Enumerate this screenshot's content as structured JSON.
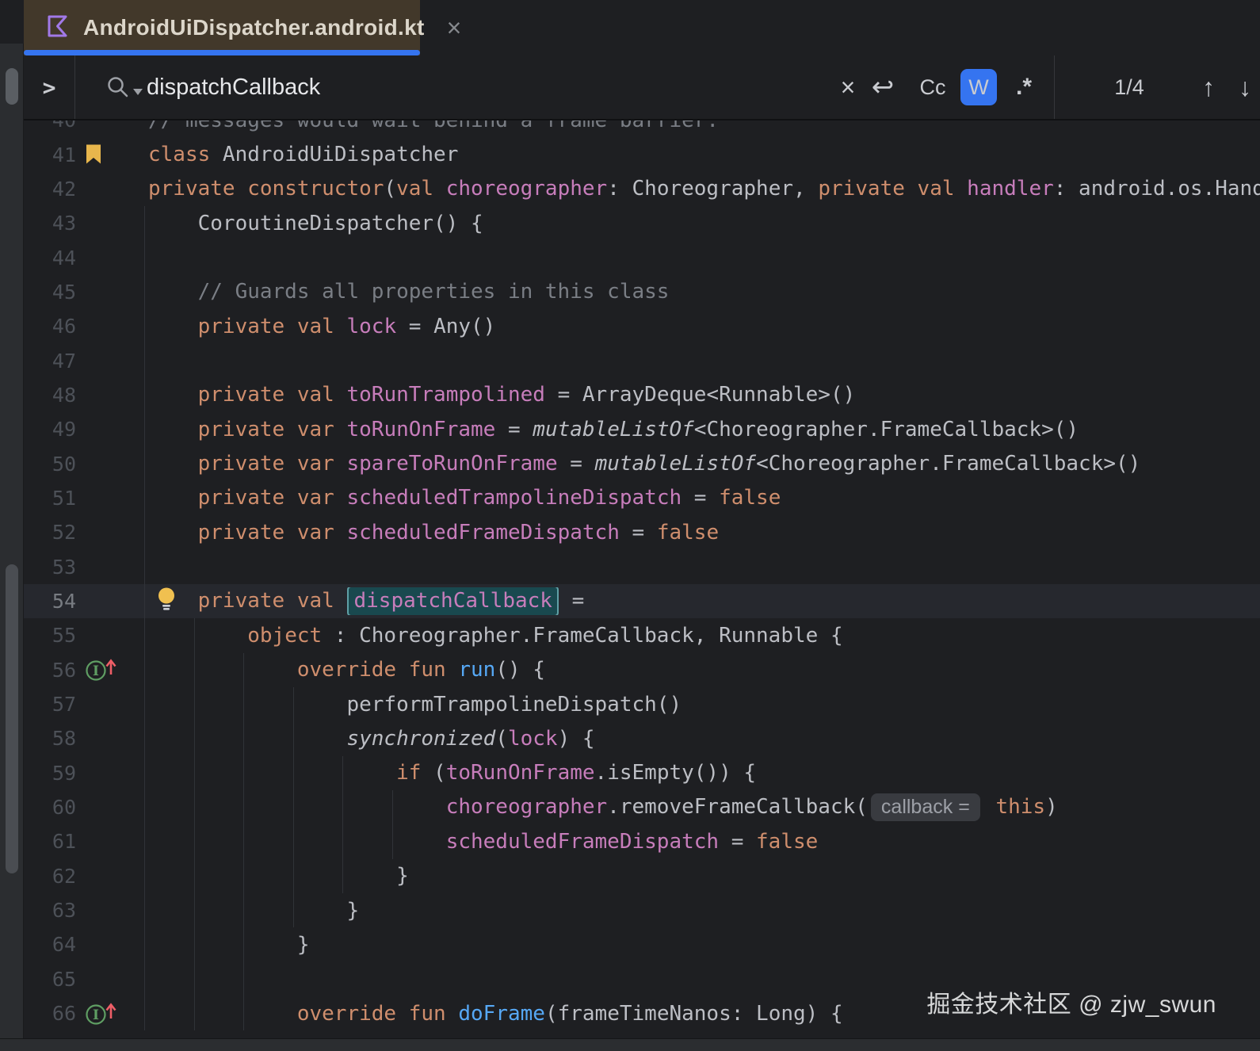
{
  "tab": {
    "title": "AndroidUiDispatcher.android.kt",
    "close_label": "×",
    "icon": "kotlin-file-icon",
    "accent_color": "#3574f0",
    "tab_color": "#42382a"
  },
  "search": {
    "expand_chevron": ">",
    "query": "dispatchCallback",
    "clear_label": "×",
    "newline_label": "↩",
    "match_case_label": "Cc",
    "words_label": "W",
    "regex_label": ".*",
    "count": "1/4",
    "prev_label": "↑",
    "next_label": "↓",
    "words_active_color": "#3574f0"
  },
  "watermark": "掘金技术社区 @ zjw_swun",
  "editor": {
    "colors": {
      "keyword": "#cf8e6d",
      "property": "#c77dbb",
      "function": "#56a8f5",
      "comment": "#7a7e85",
      "default": "#bcbec4",
      "match_bg": "#19494f",
      "current_line": "#26282e"
    },
    "guides": [
      {
        "col": 0,
        "from": 43,
        "to": 66
      },
      {
        "col": 4,
        "from": 55,
        "to": 66
      },
      {
        "col": 8,
        "from": 56,
        "to": 66
      },
      {
        "col": 12,
        "from": 57,
        "to": 63
      },
      {
        "col": 16,
        "from": 59,
        "to": 62
      },
      {
        "col": 20,
        "from": 60,
        "to": 61
      }
    ],
    "lines": [
      {
        "n": 40,
        "seg": [
          {
            "c": "c",
            "t": "// messages would wait behind a frame barrier."
          }
        ]
      },
      {
        "n": 41,
        "icon": "bookmark-icon",
        "seg": [
          {
            "c": "k",
            "t": "class"
          },
          {
            "c": "d",
            "t": " AndroidUiDispatcher"
          }
        ]
      },
      {
        "n": 42,
        "seg": [
          {
            "c": "k",
            "t": "private"
          },
          {
            "c": "d",
            "t": " "
          },
          {
            "c": "k",
            "t": "constructor"
          },
          {
            "c": "d",
            "t": "("
          },
          {
            "c": "k",
            "t": "val"
          },
          {
            "c": "d",
            "t": " "
          },
          {
            "c": "p",
            "t": "choreographer"
          },
          {
            "c": "d",
            "t": ": Choreographer, "
          },
          {
            "c": "k",
            "t": "private"
          },
          {
            "c": "d",
            "t": " "
          },
          {
            "c": "k",
            "t": "val"
          },
          {
            "c": "d",
            "t": " "
          },
          {
            "c": "p",
            "t": "handler"
          },
          {
            "c": "d",
            "t": ": android.os.Handler) :"
          }
        ]
      },
      {
        "n": 43,
        "seg": [
          {
            "c": "d",
            "t": "    CoroutineDispatcher() {"
          }
        ]
      },
      {
        "n": 44,
        "seg": []
      },
      {
        "n": 45,
        "seg": [
          {
            "c": "c",
            "t": "    // Guards all properties in this class"
          }
        ]
      },
      {
        "n": 46,
        "seg": [
          {
            "c": "d",
            "t": "    "
          },
          {
            "c": "k",
            "t": "private"
          },
          {
            "c": "d",
            "t": " "
          },
          {
            "c": "k",
            "t": "val"
          },
          {
            "c": "d",
            "t": " "
          },
          {
            "c": "p",
            "t": "lock"
          },
          {
            "c": "d",
            "t": " = Any()"
          }
        ]
      },
      {
        "n": 47,
        "seg": []
      },
      {
        "n": 48,
        "seg": [
          {
            "c": "d",
            "t": "    "
          },
          {
            "c": "k",
            "t": "private"
          },
          {
            "c": "d",
            "t": " "
          },
          {
            "c": "k",
            "t": "val"
          },
          {
            "c": "d",
            "t": " "
          },
          {
            "c": "p",
            "t": "toRunTrampolined"
          },
          {
            "c": "d",
            "t": " = ArrayDeque<Runnable>()"
          }
        ]
      },
      {
        "n": 49,
        "seg": [
          {
            "c": "d",
            "t": "    "
          },
          {
            "c": "k",
            "t": "private"
          },
          {
            "c": "d",
            "t": " "
          },
          {
            "c": "k",
            "t": "var"
          },
          {
            "c": "d",
            "t": " "
          },
          {
            "c": "u",
            "t": "toRunOnFrame"
          },
          {
            "c": "d",
            "t": " = "
          },
          {
            "c": "i",
            "t": "mutableListOf"
          },
          {
            "c": "d",
            "t": "<Choreographer.FrameCallback>()"
          }
        ]
      },
      {
        "n": 50,
        "seg": [
          {
            "c": "d",
            "t": "    "
          },
          {
            "c": "k",
            "t": "private"
          },
          {
            "c": "d",
            "t": " "
          },
          {
            "c": "k",
            "t": "var"
          },
          {
            "c": "d",
            "t": " "
          },
          {
            "c": "u",
            "t": "spareToRunOnFrame"
          },
          {
            "c": "d",
            "t": " = "
          },
          {
            "c": "i",
            "t": "mutableListOf"
          },
          {
            "c": "d",
            "t": "<Choreographer.FrameCallback>()"
          }
        ]
      },
      {
        "n": 51,
        "seg": [
          {
            "c": "d",
            "t": "    "
          },
          {
            "c": "k",
            "t": "private"
          },
          {
            "c": "d",
            "t": " "
          },
          {
            "c": "k",
            "t": "var"
          },
          {
            "c": "d",
            "t": " "
          },
          {
            "c": "u",
            "t": "scheduledTrampolineDispatch"
          },
          {
            "c": "d",
            "t": " = "
          },
          {
            "c": "k",
            "t": "false"
          }
        ]
      },
      {
        "n": 52,
        "seg": [
          {
            "c": "d",
            "t": "    "
          },
          {
            "c": "k",
            "t": "private"
          },
          {
            "c": "d",
            "t": " "
          },
          {
            "c": "k",
            "t": "var"
          },
          {
            "c": "d",
            "t": " "
          },
          {
            "c": "u",
            "t": "scheduledFrameDispatch"
          },
          {
            "c": "d",
            "t": " = "
          },
          {
            "c": "k",
            "t": "false"
          }
        ]
      },
      {
        "n": 53,
        "seg": []
      },
      {
        "n": 54,
        "current": true,
        "icon": "lightbulb-icon",
        "seg": [
          {
            "c": "d",
            "t": "    "
          },
          {
            "c": "k",
            "t": "private"
          },
          {
            "c": "d",
            "t": " "
          },
          {
            "c": "k",
            "t": "val"
          },
          {
            "c": "d",
            "t": " "
          },
          {
            "c": "m",
            "t": "dispatchCallback"
          },
          {
            "c": "d",
            "t": " ="
          }
        ]
      },
      {
        "n": 55,
        "seg": [
          {
            "c": "d",
            "t": "        "
          },
          {
            "c": "k",
            "t": "object"
          },
          {
            "c": "d",
            "t": " : Choreographer.FrameCallback, Runnable {"
          }
        ]
      },
      {
        "n": 56,
        "icon": "override-icon",
        "seg": [
          {
            "c": "d",
            "t": "            "
          },
          {
            "c": "k",
            "t": "override"
          },
          {
            "c": "d",
            "t": " "
          },
          {
            "c": "k",
            "t": "fun"
          },
          {
            "c": "d",
            "t": " "
          },
          {
            "c": "f",
            "t": "run"
          },
          {
            "c": "d",
            "t": "() {"
          }
        ]
      },
      {
        "n": 57,
        "seg": [
          {
            "c": "d",
            "t": "                performTrampolineDispatch()"
          }
        ]
      },
      {
        "n": 58,
        "seg": [
          {
            "c": "d",
            "t": "                "
          },
          {
            "c": "i",
            "t": "synchronized"
          },
          {
            "c": "d",
            "t": "("
          },
          {
            "c": "p",
            "t": "lock"
          },
          {
            "c": "d",
            "t": ") {"
          }
        ]
      },
      {
        "n": 59,
        "seg": [
          {
            "c": "d",
            "t": "                    "
          },
          {
            "c": "k",
            "t": "if"
          },
          {
            "c": "d",
            "t": " ("
          },
          {
            "c": "u",
            "t": "toRunOnFrame"
          },
          {
            "c": "d",
            "t": ".isEmpty()) {"
          }
        ]
      },
      {
        "n": 60,
        "seg": [
          {
            "c": "d",
            "t": "                        "
          },
          {
            "c": "p",
            "t": "choreographer"
          },
          {
            "c": "d",
            "t": ".removeFrameCallback("
          },
          {
            "c": "h",
            "t": "callback ="
          },
          {
            "c": "d",
            "t": " "
          },
          {
            "c": "k",
            "t": "this"
          },
          {
            "c": "d",
            "t": ")"
          }
        ]
      },
      {
        "n": 61,
        "seg": [
          {
            "c": "d",
            "t": "                        "
          },
          {
            "c": "u",
            "t": "scheduledFrameDispatch"
          },
          {
            "c": "d",
            "t": " = "
          },
          {
            "c": "k",
            "t": "false"
          }
        ]
      },
      {
        "n": 62,
        "seg": [
          {
            "c": "d",
            "t": "                    }"
          }
        ]
      },
      {
        "n": 63,
        "seg": [
          {
            "c": "d",
            "t": "                }"
          }
        ]
      },
      {
        "n": 64,
        "seg": [
          {
            "c": "d",
            "t": "            }"
          }
        ]
      },
      {
        "n": 65,
        "seg": []
      },
      {
        "n": 66,
        "icon": "override-icon",
        "seg": [
          {
            "c": "d",
            "t": "            "
          },
          {
            "c": "k",
            "t": "override"
          },
          {
            "c": "d",
            "t": " "
          },
          {
            "c": "k",
            "t": "fun"
          },
          {
            "c": "d",
            "t": " "
          },
          {
            "c": "f",
            "t": "doFrame"
          },
          {
            "c": "d",
            "t": "(frameTimeNanos: Long) {"
          }
        ]
      }
    ]
  }
}
